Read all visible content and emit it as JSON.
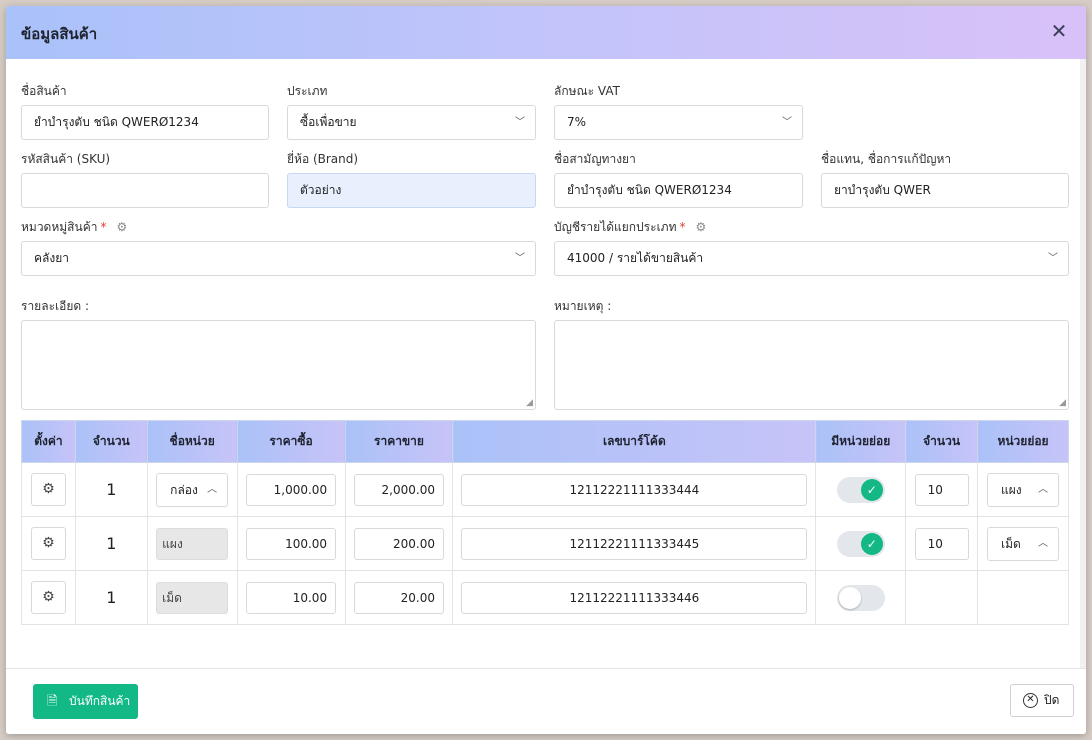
{
  "modal": {
    "title": "ข้อมูลสินค้า",
    "close_icon": "close-icon"
  },
  "form": {
    "product_name": {
      "label": "ชื่อสินค้า",
      "value": "ยำบำรุงตับ ชนิด QWERØ1234"
    },
    "type": {
      "label": "ประเภท",
      "value": "ซื้อเพื่อขาย"
    },
    "vat": {
      "label": "ลักษณะ VAT",
      "value": "7%"
    },
    "sku": {
      "label": "รหัสสินค้า (SKU)",
      "value": ""
    },
    "brand": {
      "label": "ยี่ห้อ (Brand)",
      "value": "ตัวอย่าง"
    },
    "generic_name": {
      "label": "ชื่อสามัญทางยา",
      "value": "ยำบำรุงตับ ชนิด QWERØ1234"
    },
    "alias": {
      "label": "ชื่อแทน, ชื่อการแก้ปัญหา",
      "value": "ยาบำรุงตับ QWER"
    },
    "category": {
      "label": "หมวดหมู่สินค้า",
      "required": "*",
      "value": "คลังยา"
    },
    "revenue_account": {
      "label": "บัญชีรายได้แยกประเภท",
      "required": "*",
      "value": "41000 / รายได้ขายสินค้า"
    },
    "details": {
      "label": "รายละเอียด :",
      "value": ""
    },
    "notes": {
      "label": "หมายเหตุ :",
      "value": ""
    }
  },
  "units_table": {
    "headers": [
      "ตั้งค่า",
      "จำนวน",
      "ชื่อหน่วย",
      "ราคาซื้อ",
      "ราคาขาย",
      "เลขบาร์โค้ด",
      "มีหน่วยย่อย",
      "จำนวน",
      "หน่วยย่อย"
    ],
    "rows": [
      {
        "qty": "1",
        "unit": "กล่อง",
        "buy": "1,000.00",
        "sell": "2,000.00",
        "barcode": "12112221111333444",
        "has_sub": true,
        "sub_qty": "10",
        "sub_unit": "แผง"
      },
      {
        "qty": "1",
        "unit": "แผง",
        "buy": "100.00",
        "sell": "200.00",
        "barcode": "12112221111333445",
        "has_sub": true,
        "sub_qty": "10",
        "sub_unit": "เม็ด"
      },
      {
        "qty": "1",
        "unit": "เม็ด",
        "buy": "10.00",
        "sell": "20.00",
        "barcode": "12112221111333446",
        "has_sub": false,
        "sub_qty": "",
        "sub_unit": ""
      }
    ]
  },
  "footer": {
    "save_label": "บันทึกสินค้า",
    "close_label": "ปิด"
  },
  "colors": {
    "accent": "#12b886",
    "header_start": "#a9c2f9",
    "header_end": "#d8c1f8"
  }
}
